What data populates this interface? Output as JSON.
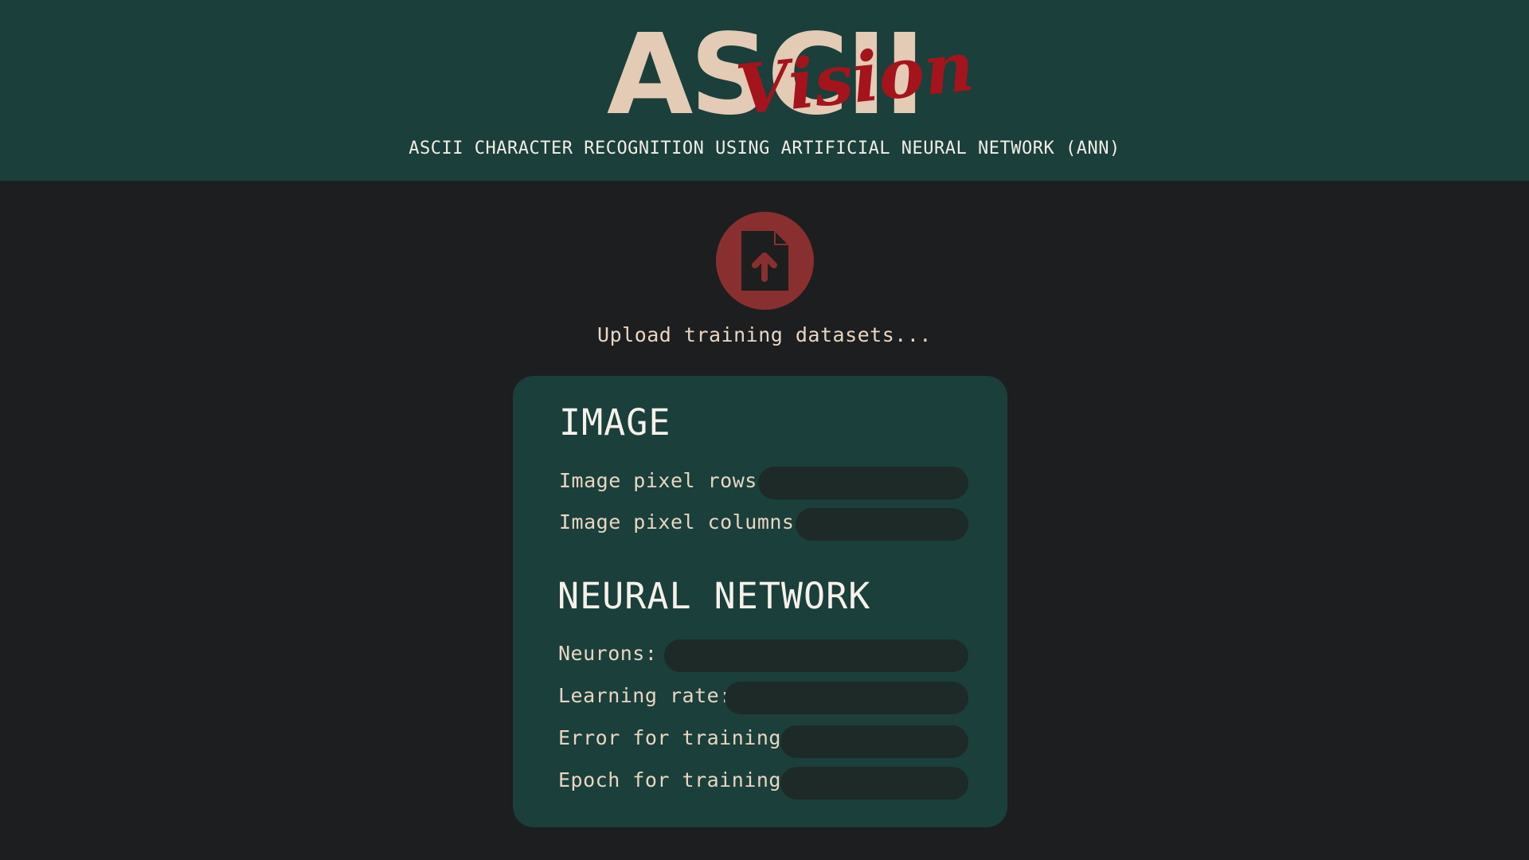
{
  "header": {
    "logo_main": "ASCII",
    "logo_script": "Vision",
    "subtitle": "ASCII CHARACTER RECOGNITION USING ARTIFICIAL NEURAL NETWORK (ANN)"
  },
  "upload": {
    "icon": "file-upload-icon",
    "label": "Upload training datasets..."
  },
  "image_section": {
    "title": "IMAGE",
    "fields": [
      {
        "label": "Image pixel rows:",
        "value": ""
      },
      {
        "label": "Image pixel columns:",
        "value": ""
      }
    ]
  },
  "nn_section": {
    "title": "NEURAL NETWORK",
    "fields": [
      {
        "label": "Neurons:",
        "value": ""
      },
      {
        "label": "Learning rate:",
        "value": ""
      },
      {
        "label": "Error for training:",
        "value": ""
      },
      {
        "label": "Epoch for training:",
        "value": ""
      }
    ]
  },
  "colors": {
    "header_bg": "#1b3f3a",
    "page_bg": "#1c1e1f",
    "logo_main": "#e3cbb6",
    "logo_script": "#a5141c",
    "accent": "#8a2f2f",
    "input_bg": "#1d2a27"
  }
}
